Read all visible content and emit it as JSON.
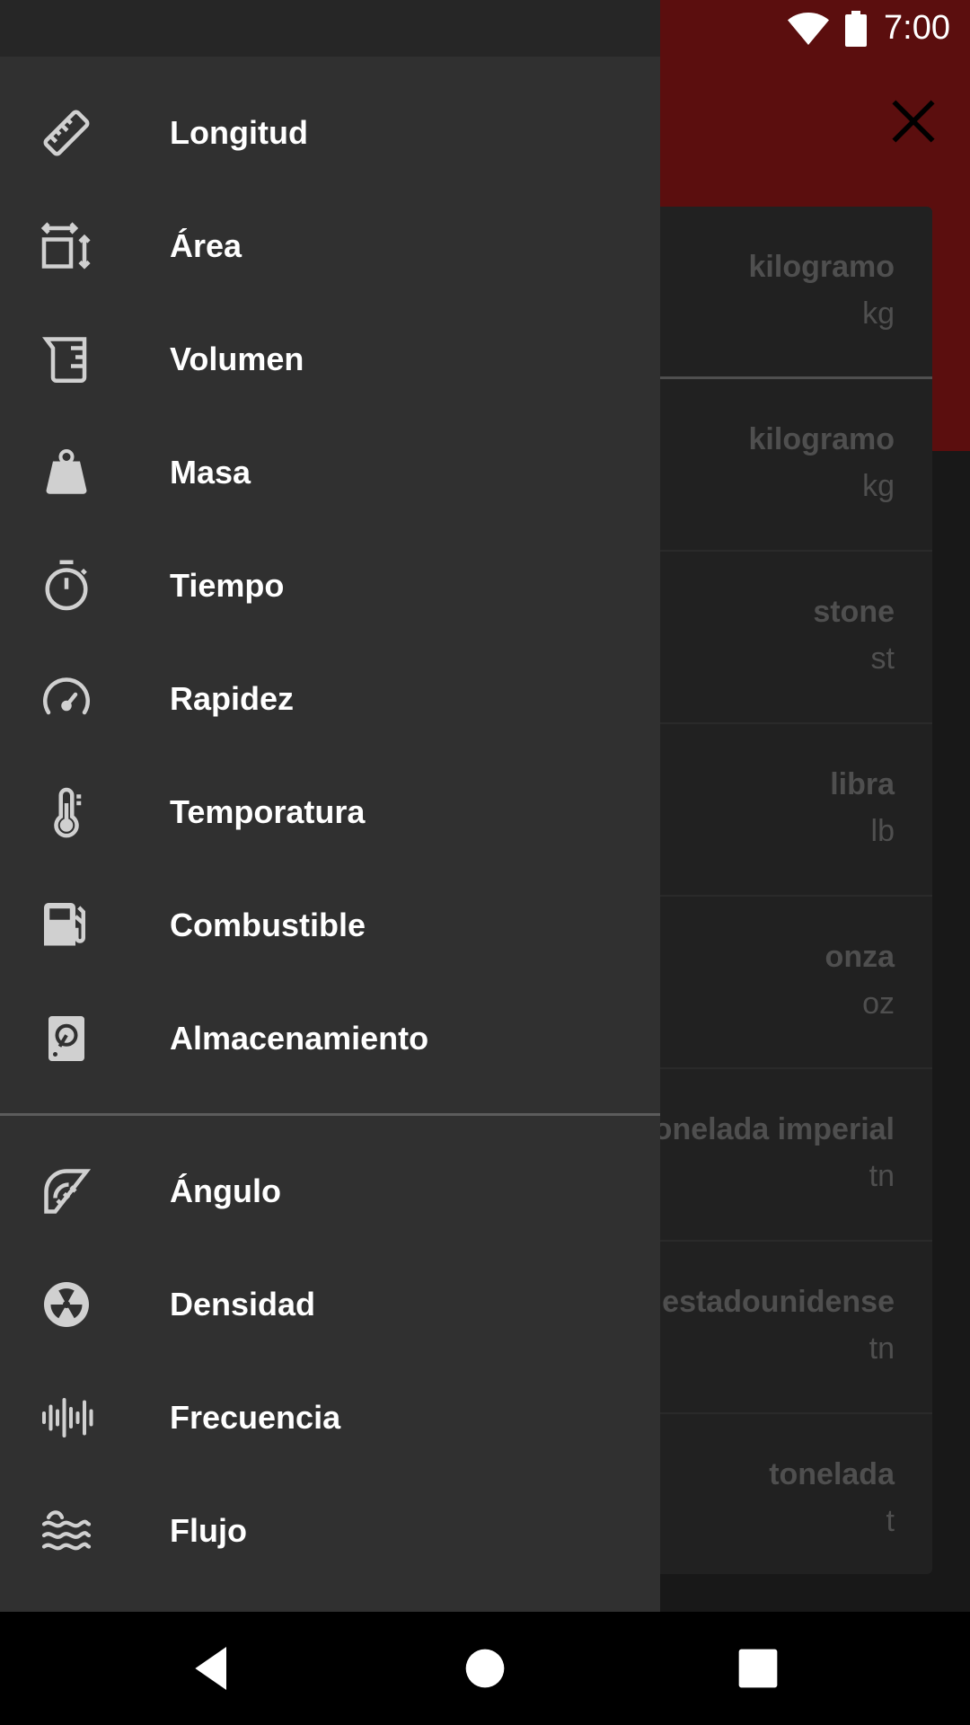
{
  "status_bar": {
    "time": "7:00",
    "icons": [
      "wifi-icon",
      "battery-icon"
    ]
  },
  "app": {
    "close_icon": "close-icon",
    "header_color": "#b71c1c",
    "units": [
      {
        "name": "kilogramo",
        "symbol": "kg"
      },
      {
        "name": "kilogramo",
        "symbol": "kg"
      },
      {
        "name": "stone",
        "symbol": "st"
      },
      {
        "name": "libra",
        "symbol": "lb"
      },
      {
        "name": "onza",
        "symbol": "oz"
      },
      {
        "name": "tonelada imperial",
        "symbol": "tn"
      },
      {
        "name": "tonelada estadounidense",
        "symbol": "tn"
      },
      {
        "name": "tonelada",
        "symbol": "t"
      }
    ]
  },
  "drawer": {
    "primary_items": [
      {
        "label": "Longitud",
        "icon": "ruler-icon"
      },
      {
        "label": "Área",
        "icon": "area-icon"
      },
      {
        "label": "Volumen",
        "icon": "volume-icon"
      },
      {
        "label": "Masa",
        "icon": "weight-icon"
      },
      {
        "label": "Tiempo",
        "icon": "timer-icon"
      },
      {
        "label": "Rapidez",
        "icon": "speedometer-icon"
      },
      {
        "label": "Temporatura",
        "icon": "thermometer-icon"
      },
      {
        "label": "Combustible",
        "icon": "fuel-icon"
      },
      {
        "label": "Almacenamiento",
        "icon": "storage-icon"
      }
    ],
    "secondary_items": [
      {
        "label": "Ángulo",
        "icon": "angle-icon"
      },
      {
        "label": "Densidad",
        "icon": "density-icon"
      },
      {
        "label": "Frecuencia",
        "icon": "frequency-icon"
      },
      {
        "label": "Flujo",
        "icon": "flow-icon"
      }
    ]
  },
  "system_nav": {
    "icons": [
      "back-icon",
      "home-icon",
      "recents-icon"
    ]
  }
}
